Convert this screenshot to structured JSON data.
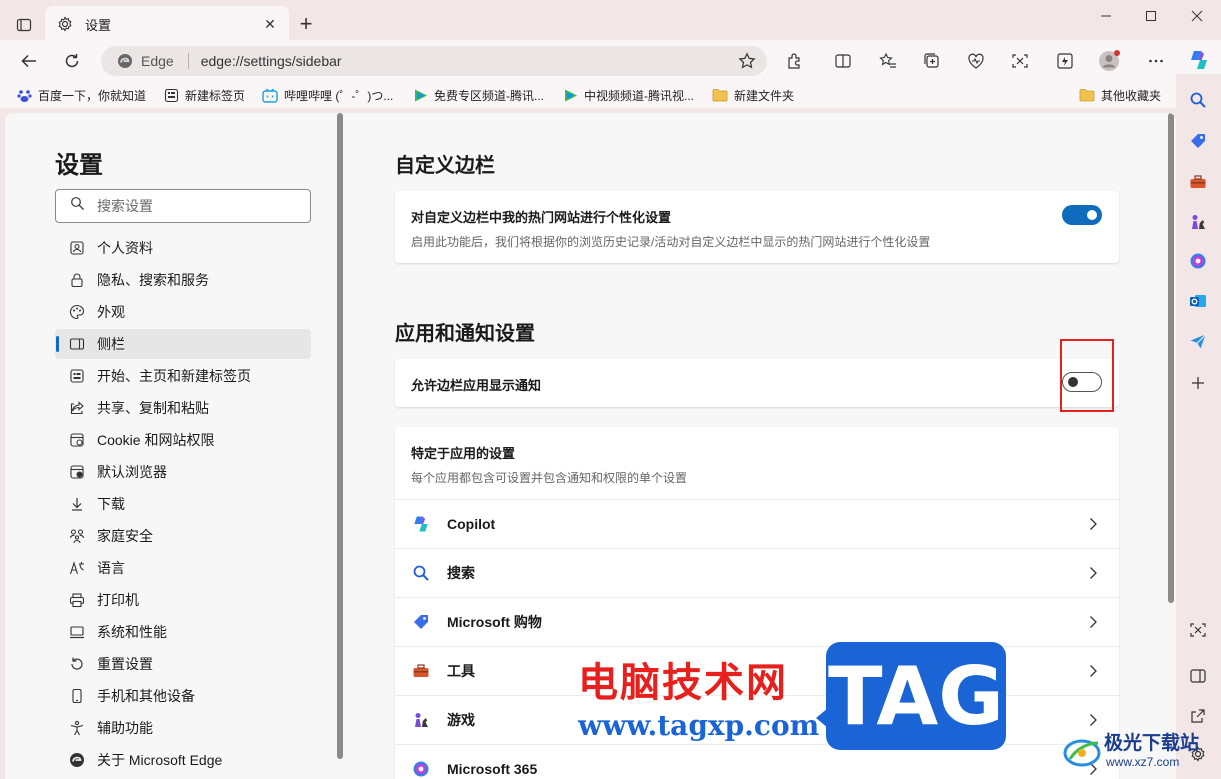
{
  "tab": {
    "title": "设置",
    "close": "✕"
  },
  "newtab": "+",
  "window": {
    "minimize": "—",
    "maximize": "☐",
    "close": "✕"
  },
  "address": {
    "site": "Edge",
    "url": "edge://settings/sidebar"
  },
  "bookmarks": [
    {
      "label": "百度一下，你就知道",
      "icon": "baidu-icon"
    },
    {
      "label": "新建标签页",
      "icon": "newtab-page-icon"
    },
    {
      "label": "哔哩哔哩 (゜-゜)つ...",
      "icon": "bilibili-icon"
    },
    {
      "label": "免费专区频道-腾讯...",
      "icon": "tencent-video-icon"
    },
    {
      "label": "中视频频道-腾讯视...",
      "icon": "tencent-video-icon"
    },
    {
      "label": "新建文件夹",
      "icon": "folder-icon"
    }
  ],
  "other_favorites": "其他收藏夹",
  "settings": {
    "title": "设置",
    "search_placeholder": "搜索设置",
    "nav": [
      {
        "label": "个人资料",
        "icon": "profile-icon"
      },
      {
        "label": "隐私、搜索和服务",
        "icon": "lock-icon"
      },
      {
        "label": "外观",
        "icon": "appearance-icon"
      },
      {
        "label": "侧栏",
        "icon": "sidebar-icon",
        "active": true
      },
      {
        "label": "开始、主页和新建标签页",
        "icon": "home-icon"
      },
      {
        "label": "共享、复制和粘贴",
        "icon": "share-icon"
      },
      {
        "label": "Cookie 和网站权限",
        "icon": "cookie-icon"
      },
      {
        "label": "默认浏览器",
        "icon": "browser-icon"
      },
      {
        "label": "下载",
        "icon": "download-icon"
      },
      {
        "label": "家庭安全",
        "icon": "family-icon"
      },
      {
        "label": "语言",
        "icon": "language-icon"
      },
      {
        "label": "打印机",
        "icon": "printer-icon"
      },
      {
        "label": "系统和性能",
        "icon": "system-icon"
      },
      {
        "label": "重置设置",
        "icon": "reset-icon"
      },
      {
        "label": "手机和其他设备",
        "icon": "phone-icon"
      },
      {
        "label": "辅助功能",
        "icon": "accessibility-icon"
      },
      {
        "label": "关于 Microsoft Edge",
        "icon": "edge-icon"
      }
    ]
  },
  "main": {
    "section1": {
      "title": "自定义边栏",
      "card_title": "对自定义边栏中我的热门网站进行个性化设置",
      "card_desc": "启用此功能后，我们将根据你的浏览历史记录/活动对自定义边栏中显示的热门网站进行个性化设置",
      "toggle_on": true
    },
    "section2": {
      "title": "应用和通知设置",
      "notify_label": "允许边栏应用显示通知",
      "toggle_on": false,
      "apps_title": "特定于应用的设置",
      "apps_desc": "每个应用都包含可设置并包含通知和权限的单个设置",
      "apps": [
        {
          "name": "Copilot",
          "icon": "copilot-icon"
        },
        {
          "name": "搜索",
          "icon": "search-icon"
        },
        {
          "name": "Microsoft 购物",
          "icon": "shopping-tag-icon"
        },
        {
          "name": "工具",
          "icon": "toolbox-icon"
        },
        {
          "name": "游戏",
          "icon": "chess-icon"
        },
        {
          "name": "Microsoft 365",
          "icon": "m365-icon"
        }
      ]
    }
  },
  "watermark": {
    "cn": "电脑技术网",
    "url": "www.tagxp.com",
    "tag": "TAG",
    "brand": "极光下载站",
    "brand_url": "www.xz7.com"
  },
  "colors": {
    "accent": "#0f6cbd",
    "highlight": "#e8201d",
    "chrome": "#f3e6e7"
  }
}
